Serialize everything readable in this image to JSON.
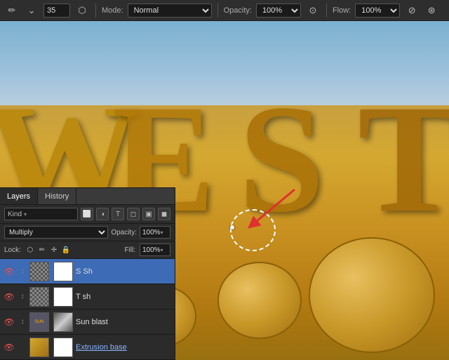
{
  "toolbar": {
    "brush_size": "35",
    "mode_label": "Mode:",
    "mode_value": "Normal",
    "opacity_label": "Opacity:",
    "opacity_value": "100%",
    "flow_label": "Flow:",
    "flow_value": "100%"
  },
  "panels": {
    "layers_tab": "Layers",
    "history_tab": "History",
    "search_label": "Kind",
    "blend_mode": "Multiply",
    "opacity_label": "Opacity:",
    "opacity_value": "100%",
    "lock_label": "Lock:",
    "fill_label": "Fill:",
    "fill_value": "100%",
    "layers": [
      {
        "name": "S Sh",
        "visible": true,
        "active": true,
        "has_mask": true
      },
      {
        "name": "T sh",
        "visible": true,
        "active": false,
        "has_mask": true
      },
      {
        "name": "Sun blast",
        "visible": true,
        "active": false,
        "has_mask": true,
        "has_thumb": true
      },
      {
        "name": "Extrusion base",
        "visible": true,
        "active": false,
        "has_mask": false,
        "underline": true
      }
    ]
  }
}
